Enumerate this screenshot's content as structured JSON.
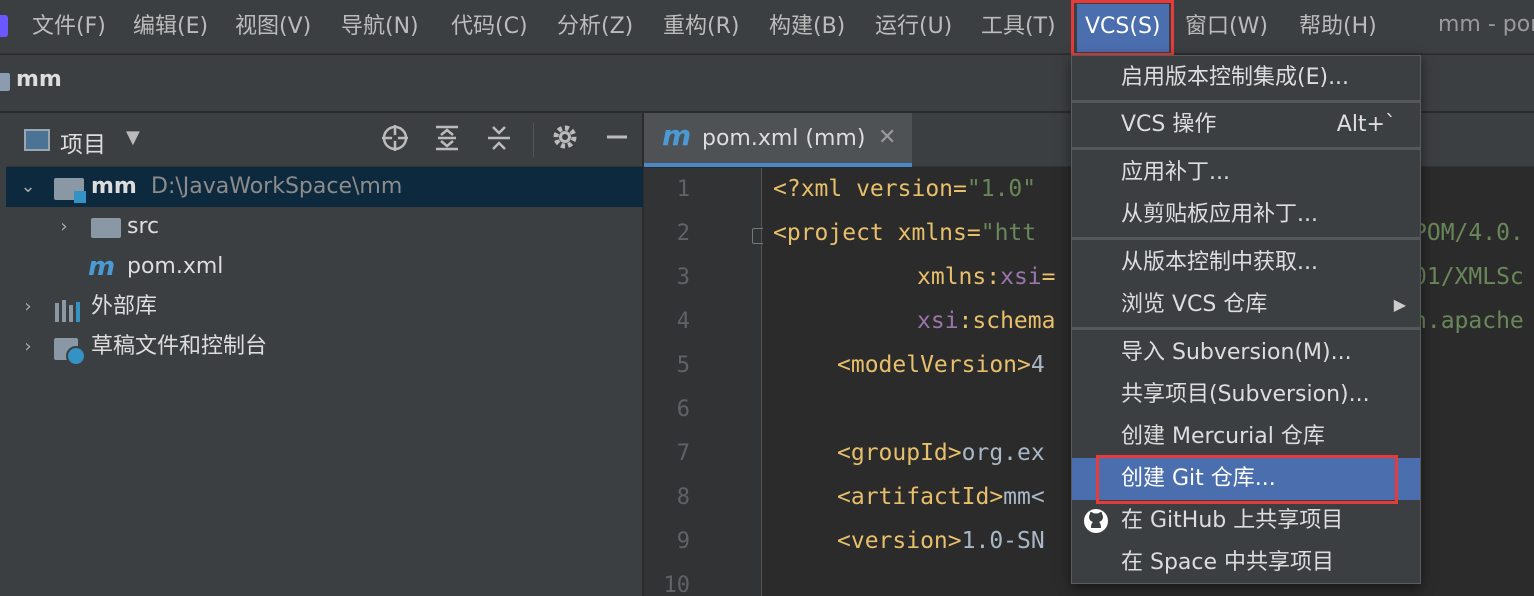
{
  "menubar": {
    "items": [
      "文件(F)",
      "编辑(E)",
      "视图(V)",
      "导航(N)",
      "代码(C)",
      "分析(Z)",
      "重构(R)",
      "构建(B)",
      "运行(U)",
      "工具(T)",
      "VCS(S)",
      "窗口(W)",
      "帮助(H)"
    ],
    "active_item": "VCS(S)",
    "window_title": "mm - pom.xml"
  },
  "navbar": {
    "project_name": "mm"
  },
  "project_panel": {
    "title": "项目",
    "tree": {
      "root_name": "mm",
      "root_path": "D:\\JavaWorkSpace\\mm",
      "src": "src",
      "pom": "pom.xml",
      "external_libs": "外部库",
      "scratches": "草稿文件和控制台"
    }
  },
  "editor": {
    "tab_label": "pom.xml (mm)",
    "line_numbers": [
      "1",
      "2",
      "3",
      "4",
      "5",
      "6",
      "7",
      "8",
      "9",
      "10"
    ],
    "code": {
      "l1": [
        "<?xml version=",
        "\"1.0\""
      ],
      "l2": [
        "<project xmlns=",
        "\"htt",
        "POM/4.0."
      ],
      "l3": [
        "xmlns:",
        "xsi",
        "=",
        "01/XMLSc"
      ],
      "l4": [
        "xsi",
        ":schema",
        "n.apache"
      ],
      "l5": [
        "<modelVersion>",
        "4"
      ],
      "l7": [
        "<groupId>",
        "org.ex"
      ],
      "l8": [
        "<artifactId>",
        "mm<"
      ],
      "l9": [
        "<version>",
        "1.0-SN"
      ]
    }
  },
  "vcs_menu": {
    "enable_vcs": "启用版本控制集成(E)...",
    "vcs_ops": "VCS 操作",
    "vcs_ops_shortcut": "Alt+`",
    "apply_patch": "应用补丁...",
    "apply_patch_clipboard": "从剪贴板应用补丁...",
    "get_from_vcs": "从版本控制中获取...",
    "browse_vcs": "浏览 VCS 仓库",
    "import_svn": "导入 Subversion(M)...",
    "share_svn": "共享项目(Subversion)...",
    "create_hg": "创建 Mercurial 仓库",
    "create_git": "创建 Git 仓库...",
    "share_github": "在 GitHub 上共享项目",
    "share_space": "在 Space 中共享项目"
  },
  "colors": {
    "highlight_border": "#e53b3b",
    "selection_blue": "#4b6eaf",
    "xml_tag": "#e8bf6a",
    "xml_string": "#6a8759",
    "xml_namespace": "#9876aa"
  }
}
